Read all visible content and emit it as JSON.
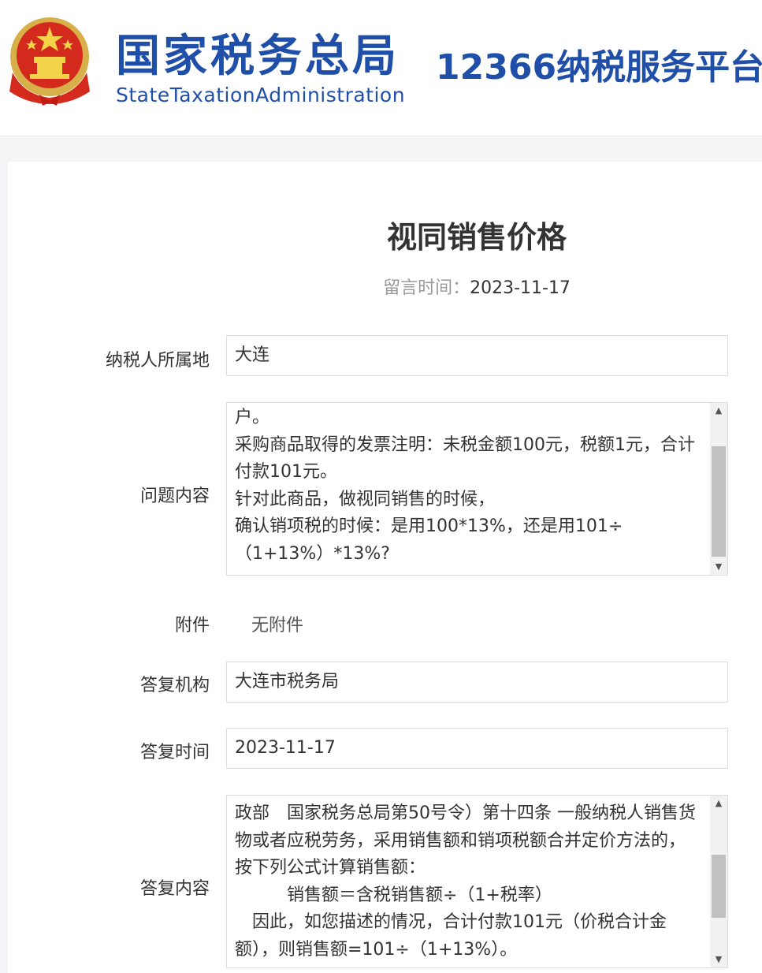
{
  "header": {
    "brand_cn": "国家税务总局",
    "brand_en": "StateTaxationAdministration",
    "platform": "12366纳税服务平台",
    "emblem_icon": "national-emblem-icon",
    "brand_color": "#1f4fa8"
  },
  "page": {
    "title": "视同销售价格",
    "message_time_label": "留言时间：",
    "message_time_value": "2023-11-17"
  },
  "form": {
    "taxpayer_location_label": "纳税人所属地",
    "taxpayer_location_value": "大连",
    "question_label": "问题内容",
    "question_text": "户。\n采购商品取得的发票注明：未税金额100元，税额1元，合计付款101元。\n针对此商品，做视同销售的时候，\n确认销项税的时候：是用100*13%，还是用101÷（1+13%）*13%?",
    "attachment_label": "附件",
    "attachment_value": "无附件",
    "reply_org_label": "答复机构",
    "reply_org_value": "大连市税务局",
    "reply_time_label": "答复时间",
    "reply_time_value": "2023-11-17",
    "reply_content_label": "答复内容",
    "reply_text": "政部　国家税务总局第50号令）第十四条 一般纳税人销售货物或者应税劳务，采用销售额和销项税额合并定价方法的，按下列公式计算销售额：\n　　　销售额＝含税销售额÷（1+税率）\n　因此，如您描述的情况，合计付款101元（价税合计金额），则销售额=101÷（1+13%）。"
  }
}
